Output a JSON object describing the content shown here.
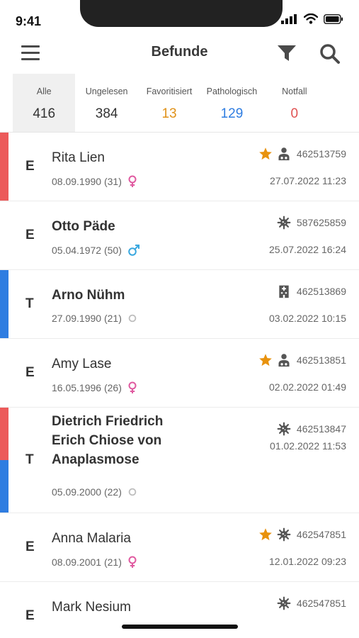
{
  "status": {
    "time": "9:41"
  },
  "header": {
    "title": "Befunde"
  },
  "tabs": [
    {
      "label": "Alle",
      "count": "416",
      "color": "#333333",
      "active": true
    },
    {
      "label": "Ungelesen",
      "count": "384",
      "color": "#333333",
      "active": false
    },
    {
      "label": "Favoritisiert",
      "count": "13",
      "color": "#e0921a",
      "active": false
    },
    {
      "label": "Pathologisch",
      "count": "129",
      "color": "#2f7de1",
      "active": false
    },
    {
      "label": "Notfall",
      "count": "0",
      "color": "#e05252",
      "active": false
    }
  ],
  "colors": {
    "red": "#ec5a5a",
    "blue": "#2f7de1",
    "star": "#e8920d",
    "female": "#e05aa0",
    "male": "#3aa8df",
    "icon_gray": "#555555"
  },
  "list": [
    {
      "type": "E",
      "name": "Rita Lien",
      "birth": "08.09.1990 (31)",
      "gender": "female",
      "id": "462513759",
      "date": "27.07.2022 11:23",
      "bar": "red",
      "bold": false,
      "icons": [
        "star-icon",
        "doctor-icon"
      ]
    },
    {
      "type": "E",
      "name": "Otto Päde",
      "birth": "05.04.1972 (50)",
      "gender": "male",
      "id": "587625859",
      "date": "25.07.2022 16:24",
      "bar": "none",
      "bold": true,
      "icons": [
        "virus-icon"
      ]
    },
    {
      "type": "T",
      "name": "Arno Nühm",
      "birth": "27.09.1990 (21)",
      "gender": "unknown",
      "id": "462513869",
      "date": "03.02.2022 10:15",
      "bar": "blue",
      "bold": true,
      "icons": [
        "hospital-icon"
      ]
    },
    {
      "type": "E",
      "name": "Amy Lase",
      "birth": "16.05.1996 (26)",
      "gender": "female",
      "id": "462513851",
      "date": "02.02.2022 01:49",
      "bar": "none",
      "bold": false,
      "icons": [
        "star-icon",
        "doctor-icon"
      ]
    },
    {
      "type": "T",
      "name": "Dietrich Friedrich Erich Chiose von Anaplasmose",
      "birth": "05.09.2000 (22)",
      "gender": "unknown",
      "id": "462513847",
      "date": "01.02.2022 11:53",
      "bar": "red-blue",
      "bold": true,
      "icons": [
        "virus-icon"
      ]
    },
    {
      "type": "E",
      "name": "Anna Malaria",
      "birth": "08.09.2001 (21)",
      "gender": "female",
      "id": "462547851",
      "date": "12.01.2022 09:23",
      "bar": "none",
      "bold": false,
      "icons": [
        "star-icon",
        "virus-icon"
      ]
    },
    {
      "type": "E",
      "name": "Mark Nesium",
      "birth": "",
      "gender": "",
      "id": "462547851",
      "date": "",
      "bar": "none",
      "bold": false,
      "icons": [
        "virus-icon"
      ]
    }
  ]
}
